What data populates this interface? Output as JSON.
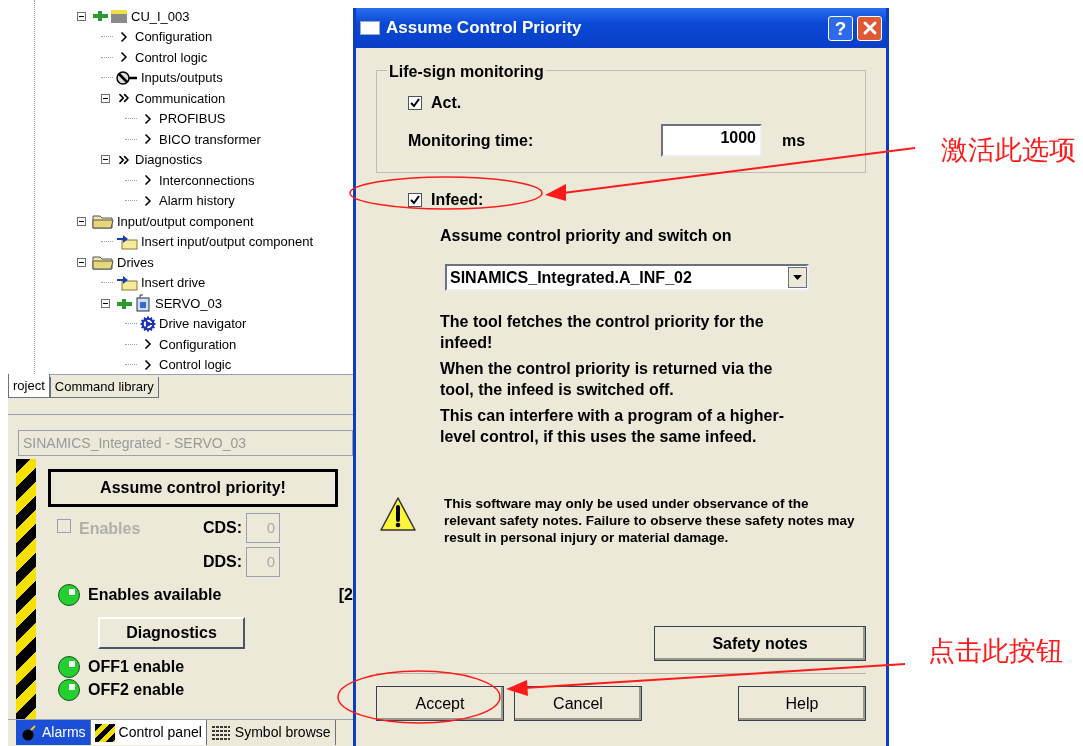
{
  "explorer": {
    "tree": [
      {
        "label": "CU_I_003",
        "kind": "unit",
        "expanded": true,
        "children": [
          {
            "label": "Configuration",
            "kind": "step"
          },
          {
            "label": "Control logic",
            "kind": "step"
          },
          {
            "label": "Inputs/outputs",
            "kind": "io"
          },
          {
            "label": "Communication",
            "kind": "group",
            "expanded": true,
            "children": [
              {
                "label": "PROFIBUS",
                "kind": "step"
              },
              {
                "label": "BICO transformer",
                "kind": "step"
              }
            ]
          },
          {
            "label": "Diagnostics",
            "kind": "group",
            "expanded": true,
            "children": [
              {
                "label": "Interconnections",
                "kind": "step"
              },
              {
                "label": "Alarm history",
                "kind": "step"
              }
            ]
          }
        ]
      },
      {
        "label": "Input/output component",
        "kind": "folder",
        "expanded": true,
        "children": [
          {
            "label": "Insert input/output component",
            "kind": "action"
          }
        ]
      },
      {
        "label": "Drives",
        "kind": "folder",
        "expanded": true,
        "children": [
          {
            "label": "Insert drive",
            "kind": "action"
          },
          {
            "label": "SERVO_03",
            "kind": "device",
            "expanded": true,
            "children": [
              {
                "label": "Drive navigator",
                "kind": "tool"
              },
              {
                "label": "Configuration",
                "kind": "step"
              },
              {
                "label": "Control logic",
                "kind": "step"
              }
            ]
          }
        ]
      }
    ],
    "tabs": [
      {
        "label": "roject",
        "selected": true
      },
      {
        "label": "Command library",
        "selected": false
      }
    ]
  },
  "control_panel": {
    "object_field": "SINAMICS_Integrated - SERVO_03",
    "assume_button": "Assume control priority!",
    "enables": {
      "label": "Enables",
      "checked": false,
      "disabled": true
    },
    "cds": {
      "label": "CDS:",
      "value": "0"
    },
    "dds": {
      "label": "DDS:",
      "value": "0"
    },
    "status": {
      "label": "Enables available",
      "on": true,
      "aside": "[2"
    },
    "diagnostics_button": "Diagnostics",
    "signals": [
      {
        "label": "OFF1 enable",
        "on": true
      },
      {
        "label": "OFF2 enable",
        "on": true
      }
    ]
  },
  "bottom_tabs": [
    {
      "label": "Alarms",
      "kind": "alarm",
      "selected": false
    },
    {
      "label": "Control panel",
      "kind": "panel",
      "selected": true
    },
    {
      "label": "Symbol browse",
      "kind": "symbol",
      "selected": false
    }
  ],
  "dialog": {
    "title": "Assume Control Priority",
    "help_button": "?",
    "life_sign": {
      "legend": "Life-sign monitoring",
      "act": {
        "label": "Act.",
        "checked": true
      },
      "time_label": "Monitoring time:",
      "time_value": "1000",
      "unit": "ms"
    },
    "infeed": {
      "label": "Infeed:",
      "checked": true
    },
    "infeed_caption": "Assume control priority and switch on",
    "infeed_select": "SINAMICS_Integrated.A_INF_02",
    "paragraphs": [
      "The tool fetches the control priority for the infeed!",
      "When the control priority is returned via the tool, the infeed is switched off.",
      "This can interfere with a program of a higher-level control, if this uses the same infeed."
    ],
    "warning": "This software may only be used under observance of the relevant safety notes. Failure to observe these safety notes may result in personal injury or material damage.",
    "safety_button": "Safety notes",
    "buttons": [
      "Accept",
      "Cancel",
      "Help"
    ]
  },
  "annotations": [
    {
      "text": "激活此选项"
    },
    {
      "text": "点击此按钮"
    }
  ]
}
